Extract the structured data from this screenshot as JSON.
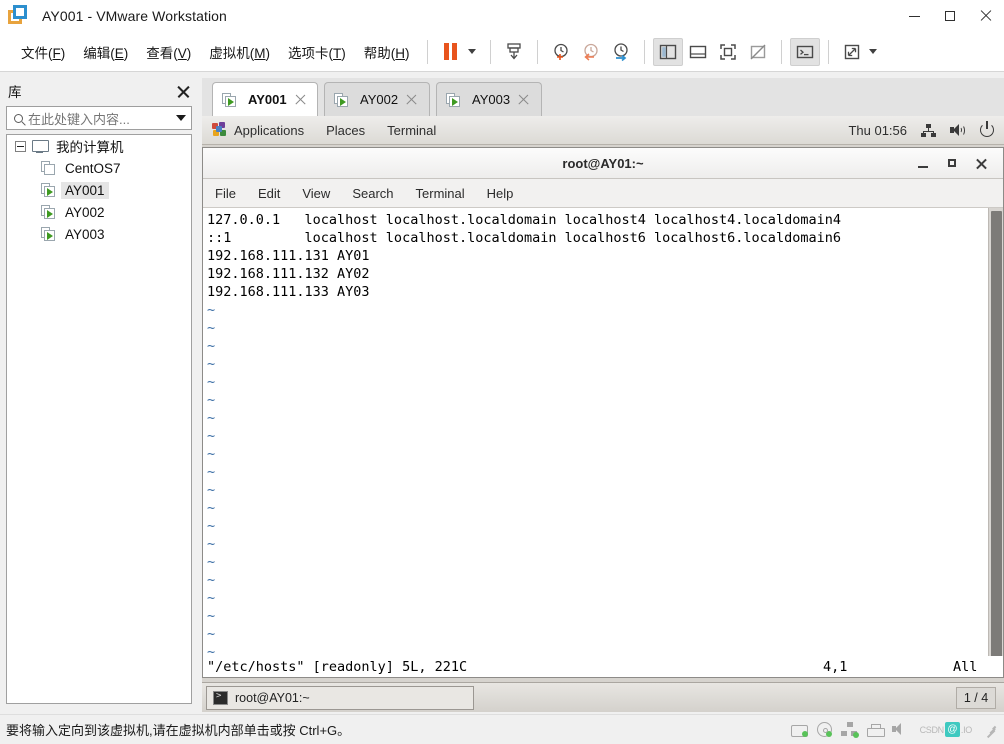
{
  "window": {
    "title": "AY001 - VMware Workstation",
    "logo_icon": "vmware-logo-icon",
    "controls": {
      "minimize": "minimize-icon",
      "maximize": "maximize-icon",
      "close": "close-icon"
    }
  },
  "menubar": {
    "items": [
      {
        "label": "文件(F)",
        "text": "文件(",
        "mnemonic": "F",
        "tail": ")"
      },
      {
        "label": "编辑(E)",
        "text": "编辑(",
        "mnemonic": "E",
        "tail": ")"
      },
      {
        "label": "查看(V)",
        "text": "查看(",
        "mnemonic": "V",
        "tail": ")"
      },
      {
        "label": "虚拟机(M)",
        "text": "虚拟机(",
        "mnemonic": "M",
        "tail": ")"
      },
      {
        "label": "选项卡(T)",
        "text": "选项卡(",
        "mnemonic": "T",
        "tail": ")"
      },
      {
        "label": "帮助(H)",
        "text": "帮助(",
        "mnemonic": "H",
        "tail": ")"
      }
    ]
  },
  "toolbar": {
    "buttons": [
      {
        "name": "suspend-button",
        "icon": "pause-icon"
      },
      {
        "name": "power-dropdown-button",
        "icon": "chevron-down-icon"
      },
      {
        "name": "manage-snapshots-button",
        "icon": "snapshot-manager-icon"
      },
      {
        "name": "take-snapshot-button",
        "icon": "take-snapshot-icon"
      },
      {
        "name": "revert-snapshot-button",
        "icon": "revert-snapshot-icon"
      },
      {
        "name": "snapshot-manager-button",
        "icon": "snapshot-settings-icon"
      },
      {
        "name": "show-library-button",
        "icon": "show-library-icon"
      },
      {
        "name": "show-thumbnail-bar-button",
        "icon": "thumbnail-bar-icon"
      },
      {
        "name": "full-screen-button",
        "icon": "full-screen-icon"
      },
      {
        "name": "unity-mode-button",
        "icon": "unity-mode-icon"
      },
      {
        "name": "console-view-button",
        "icon": "console-view-icon"
      },
      {
        "name": "stretch-guest-button",
        "icon": "stretch-icon"
      },
      {
        "name": "stretch-dropdown-button",
        "icon": "chevron-down-icon"
      }
    ]
  },
  "library": {
    "title": "库",
    "close_icon": "close-icon",
    "search": {
      "placeholder": "在此处键入内容...",
      "icon": "search-icon",
      "dropdown_icon": "chevron-down-icon"
    },
    "tree": {
      "root": {
        "label": "我的计算机",
        "icon": "monitor-icon",
        "expander": "collapse-icon"
      },
      "children": [
        {
          "label": "CentOS7",
          "state": "stopped",
          "selected": false
        },
        {
          "label": "AY001",
          "state": "running",
          "selected": true
        },
        {
          "label": "AY002",
          "state": "running",
          "selected": false
        },
        {
          "label": "AY003",
          "state": "running",
          "selected": false
        }
      ]
    }
  },
  "tabs": [
    {
      "label": "AY001",
      "active": true,
      "icon": "vm-running-icon",
      "close_icon": "close-icon"
    },
    {
      "label": "AY002",
      "active": false,
      "icon": "vm-running-icon",
      "close_icon": "close-icon"
    },
    {
      "label": "AY003",
      "active": false,
      "icon": "vm-running-icon",
      "close_icon": "close-icon"
    }
  ],
  "guest": {
    "panel": {
      "apps_icon": "gnome-applications-icon",
      "menus": [
        "Applications",
        "Places",
        "Terminal"
      ],
      "clock": "Thu 01:56",
      "tray": [
        "network-icon",
        "volume-icon",
        "power-icon"
      ]
    },
    "terminal": {
      "title": "root@AY01:~",
      "menus": [
        "File",
        "Edit",
        "View",
        "Search",
        "Terminal",
        "Help"
      ],
      "content_lines": [
        "127.0.0.1   localhost localhost.localdomain localhost4 localhost4.localdomain4",
        "::1         localhost localhost.localdomain localhost6 localhost6.localdomain6",
        "192.168.111.131 AY01",
        "192.168.111.132 AY02",
        "192.168.111.133 AY03"
      ],
      "empty_marker": "~",
      "empty_marker_count": 20,
      "status": {
        "file": "\"/etc/hosts\" [readonly] 5L, 221C",
        "position": "4,1",
        "scroll": "All"
      },
      "window_controls": {
        "minimize": "minimize-icon",
        "maximize": "maximize-icon",
        "close": "close-icon"
      }
    },
    "taskbar": {
      "window_button": {
        "label": "root@AY01:~",
        "icon": "terminal-icon"
      },
      "workspace": "1 / 4"
    }
  },
  "statusbar": {
    "message": "要将输入定向到该虚拟机,请在虚拟机内部单击或按 Ctrl+G。",
    "devices": [
      {
        "name": "hard-disk-icon"
      },
      {
        "name": "cd-dvd-icon"
      },
      {
        "name": "network-adapter-icon"
      },
      {
        "name": "printer-icon"
      },
      {
        "name": "sound-card-icon"
      }
    ],
    "watermark": {
      "text": "CSDN",
      "badge": "@",
      "suffix": ".IO"
    }
  },
  "colors": {
    "accent_orange": "#e8541d",
    "vm_running_green": "#3f9a22",
    "tab_bar_bg": "#e3e3e3",
    "vim_tilde_blue": "#3b6ea5"
  }
}
